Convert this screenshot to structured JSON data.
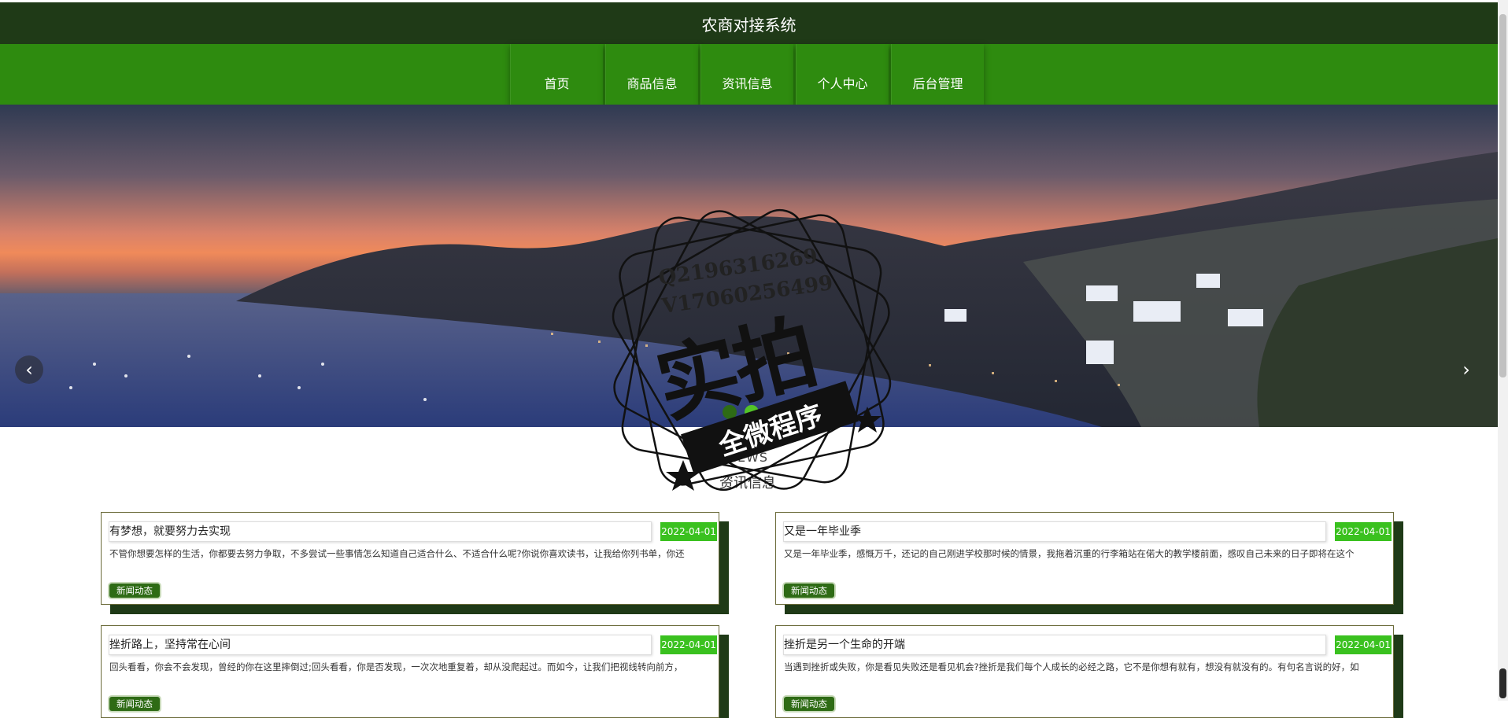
{
  "header": {
    "title": "农商对接系统"
  },
  "nav": {
    "items": [
      {
        "label": "首页"
      },
      {
        "label": "商品信息"
      },
      {
        "label": "资讯信息"
      },
      {
        "label": "个人中心"
      },
      {
        "label": "后台管理"
      }
    ]
  },
  "carousel": {
    "prev_icon": "chevron-left-icon",
    "next_icon": "chevron-right-icon",
    "prev_glyph": "‹",
    "next_glyph": "›",
    "slide_count": 2,
    "active_slide": 1
  },
  "section": {
    "subtitle": "NEWS",
    "title": "资讯信息"
  },
  "news": [
    {
      "title": "有梦想，就要努力去实现",
      "date": "2022-04-01",
      "desc": "不管你想要怎样的生活，你都要去努力争取，不多尝试一些事情怎么知道自己适合什么、不适合什么呢?你说你喜欢读书，让我给你列书单，你还",
      "tag": "新闻动态"
    },
    {
      "title": "又是一年毕业季",
      "date": "2022-04-01",
      "desc": "又是一年毕业季，感慨万千，还记的自己刚进学校那时候的情景，我拖着沉重的行李箱站在偌大的教学楼前面，感叹自己未来的日子即将在这个",
      "tag": "新闻动态"
    },
    {
      "title": "挫折路上，坚持常在心间",
      "date": "2022-04-01",
      "desc": "回头看看，你会不会发现，曾经的你在这里摔倒过;回头看看，你是否发现，一次次地重复着，却从没爬起过。而如今，让我们把视线转向前方，",
      "tag": "新闻动态"
    },
    {
      "title": "挫折是另一个生命的开端",
      "date": "2022-04-01",
      "desc": "当遇到挫折或失败，你是看见失败还是看见机会?挫折是我们每个人成长的必经之路，它不是你想有就有，想没有就没有的。有句名言说的好，如",
      "tag": "新闻动态"
    }
  ],
  "watermark": {
    "qq": "Q2196316269",
    "v": "V17060256499",
    "big": "实拍",
    "ribbon": "全微程序"
  },
  "colors": {
    "header_bg": "#1f3a17",
    "nav_bg": "#2e8b0f",
    "date_badge": "#3ac11f",
    "tag_bg": "#2e6b15"
  }
}
